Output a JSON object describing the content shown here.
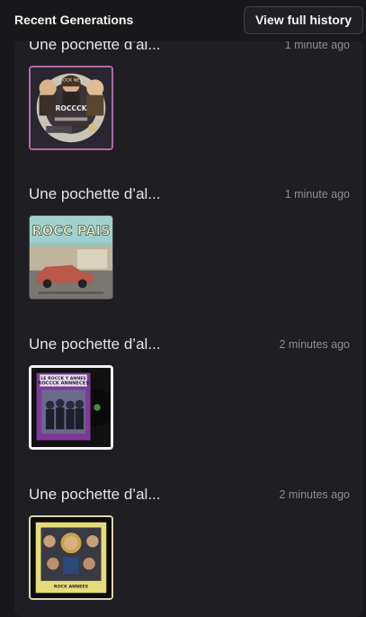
{
  "header": {
    "title": "Recent Generations",
    "history_button": "View full history"
  },
  "generations": [
    {
      "title": "Une pochette d’al...",
      "time": "1 minute ago",
      "art_text": [
        "ROCCCK",
        "ROCK NES"
      ]
    },
    {
      "title": "Une pochette d’al...",
      "time": "1 minute ago",
      "art_text": [
        "ROCC PAIS"
      ]
    },
    {
      "title": "Une pochette d’al...",
      "time": "2 minutes ago",
      "art_text": [
        "LE ROCCK Y ANNES",
        "ROCCCK ANNNECES"
      ]
    },
    {
      "title": "Une pochette d’al...",
      "time": "2 minutes ago",
      "art_text": [
        "ROCK ANNEES"
      ]
    }
  ]
}
